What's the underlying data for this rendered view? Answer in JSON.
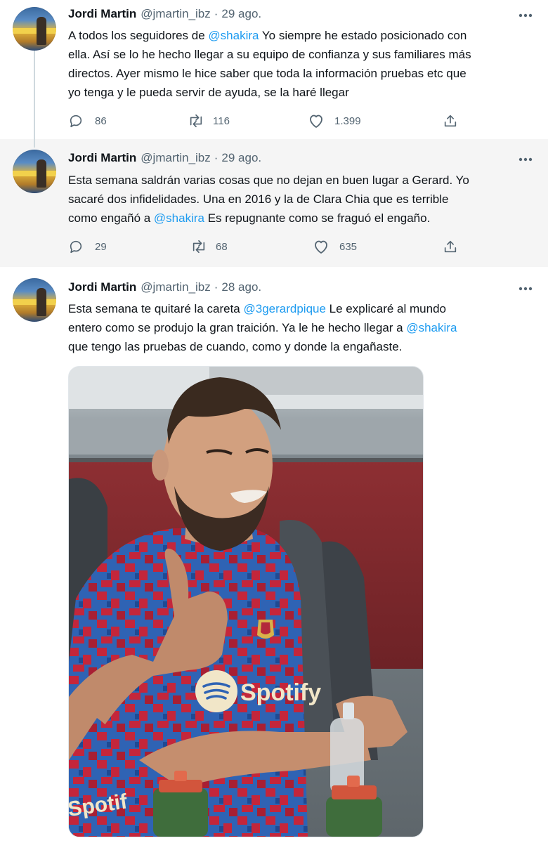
{
  "tweets": [
    {
      "name": "Jordi Martin",
      "handle": "@jmartin_ibz",
      "separator": "·",
      "date": "29 ago.",
      "lines": [
        [
          {
            "t": "A todos los seguidores de "
          },
          {
            "t": "@shakira",
            "m": true
          },
          {
            "t": " Yo siempre he estado posicionado con"
          }
        ],
        [
          {
            "t": "ella. Así se lo he hecho llegar a su equipo de confianza y sus familiares más"
          }
        ],
        [
          {
            "t": "directos. Ayer mismo le hice saber que toda la información pruebas etc que"
          }
        ],
        [
          {
            "t": "yo tenga y le pueda servir de ayuda, se la haré llegar"
          }
        ]
      ],
      "replies": "86",
      "retweets": "116",
      "likes": "1.399"
    },
    {
      "name": "Jordi Martin",
      "handle": "@jmartin_ibz",
      "separator": "·",
      "date": "29 ago.",
      "lines": [
        [
          {
            "t": "Esta semana saldrán varias cosas que no dejan en buen lugar a Gerard. Yo"
          }
        ],
        [
          {
            "t": "sacaré dos infidelidades. Una en 2016 y la de Clara Chia que es terrible"
          }
        ],
        [
          {
            "t": "como engañó a "
          },
          {
            "t": "@shakira",
            "m": true
          },
          {
            "t": " Es repugnante como se fraguó el engaño."
          }
        ]
      ],
      "replies": "29",
      "retweets": "68",
      "likes": "635"
    },
    {
      "name": "Jordi Martin",
      "handle": "@jmartin_ibz",
      "separator": "·",
      "date": "28 ago.",
      "lines": [
        [
          {
            "t": "Esta semana te quitaré la careta "
          },
          {
            "t": "@3gerardpique",
            "m": true
          },
          {
            "t": " Le explicaré al mundo"
          }
        ],
        [
          {
            "t": "entero como se produjo la gran traición. Ya le he hecho llegar a "
          },
          {
            "t": "@shakira",
            "m": true
          }
        ],
        [
          {
            "t": "que tengo las pruebas de cuando, como y donde la engañaste."
          }
        ]
      ]
    }
  ],
  "photo": {
    "shirt_sponsor": "Spotify",
    "bottle_sponsor": "Spotif"
  },
  "icons": {
    "reply": "reply-icon",
    "retweet": "retweet-icon",
    "like": "heart-icon",
    "share": "share-icon",
    "more": "more-options-icon"
  },
  "colors": {
    "mention": "#1d9bf0",
    "secondary_text": "#536471",
    "highlight_background": "#f5f5f5"
  }
}
